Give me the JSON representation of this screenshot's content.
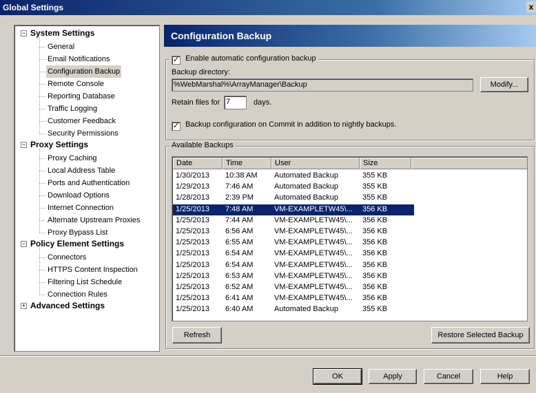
{
  "window": {
    "title": "Global Settings",
    "close_glyph": "x"
  },
  "tree": {
    "sections": [
      {
        "label": "System Settings",
        "toggle": "−",
        "items": [
          "General",
          "Email Notifications",
          "Configuration Backup",
          "Remote Console",
          "Reporting Database",
          "Traffic Logging",
          "Customer Feedback",
          "Security Permissions"
        ]
      },
      {
        "label": "Proxy Settings",
        "toggle": "−",
        "items": [
          "Proxy Caching",
          "Local Address Table",
          "Ports and Authentication",
          "Download Options",
          "Internet Connection",
          "Alternate Upstream Proxies",
          "Proxy Bypass List"
        ]
      },
      {
        "label": "Policy Element Settings",
        "toggle": "−",
        "items": [
          "Connectors",
          "HTTPS Content Inspection",
          "Filtering List Schedule",
          "Connection Rules"
        ]
      },
      {
        "label": "Advanced Settings",
        "toggle": "+",
        "items": []
      }
    ],
    "selected_item": "Configuration Backup"
  },
  "panel": {
    "title": "Configuration Backup",
    "enable_checkbox": {
      "label": "Enable automatic configuration backup",
      "checked": true
    },
    "backup_dir_label": "Backup directory:",
    "backup_dir_value": "%WebMarshal%\\ArrayManager\\Backup",
    "modify_button": "Modify...",
    "retain_prefix": "Retain files for",
    "retain_value": "7",
    "retain_suffix": "days.",
    "commit_checkbox": {
      "label": "Backup configuration on Commit in addition to nightly backups.",
      "checked": true
    },
    "available_label": "Available Backups",
    "columns": [
      "Date",
      "Time",
      "User",
      "Size"
    ],
    "rows": [
      {
        "date": "1/30/2013",
        "time": "10:38 AM",
        "user": "Automated Backup",
        "size": "355 KB"
      },
      {
        "date": "1/29/2013",
        "time": "7:46 AM",
        "user": "Automated Backup",
        "size": "355 KB"
      },
      {
        "date": "1/28/2013",
        "time": "2:39 PM",
        "user": "Automated Backup",
        "size": "355 KB"
      },
      {
        "date": "1/25/2013",
        "time": "7:48 AM",
        "user": "VM-EXAMPLETW45\\...",
        "size": "356 KB",
        "selected": true
      },
      {
        "date": "1/25/2013",
        "time": "7:44 AM",
        "user": "VM-EXAMPLETW45\\...",
        "size": "356 KB"
      },
      {
        "date": "1/25/2013",
        "time": "6:56 AM",
        "user": "VM-EXAMPLETW45\\...",
        "size": "356 KB"
      },
      {
        "date": "1/25/2013",
        "time": "6:55 AM",
        "user": "VM-EXAMPLETW45\\...",
        "size": "356 KB"
      },
      {
        "date": "1/25/2013",
        "time": "6:54 AM",
        "user": "VM-EXAMPLETW45\\...",
        "size": "356 KB"
      },
      {
        "date": "1/25/2013",
        "time": "6:54 AM",
        "user": "VM-EXAMPLETW45\\...",
        "size": "356 KB"
      },
      {
        "date": "1/25/2013",
        "time": "6:53 AM",
        "user": "VM-EXAMPLETW45\\...",
        "size": "356 KB"
      },
      {
        "date": "1/25/2013",
        "time": "6:52 AM",
        "user": "VM-EXAMPLETW45\\...",
        "size": "356 KB"
      },
      {
        "date": "1/25/2013",
        "time": "6:41 AM",
        "user": "VM-EXAMPLETW45\\...",
        "size": "356 KB"
      },
      {
        "date": "1/25/2013",
        "time": "6:40 AM",
        "user": "Automated Backup",
        "size": "355 KB"
      }
    ],
    "refresh_button": "Refresh",
    "restore_button": "Restore Selected Backup"
  },
  "footer": {
    "ok": "OK",
    "apply": "Apply",
    "cancel": "Cancel",
    "help": "Help"
  },
  "colors": {
    "selection": "#0a246a",
    "header_gradient_start": "#0a246a",
    "header_gradient_end": "#a6caf0",
    "face": "#d4d0c8"
  }
}
